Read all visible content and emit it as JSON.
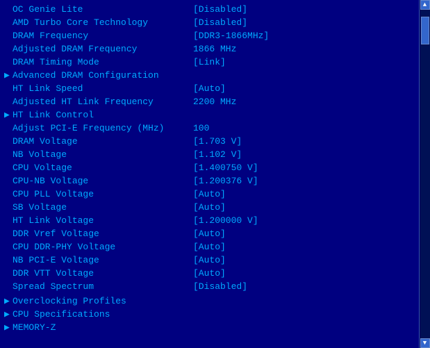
{
  "bios": {
    "rows": [
      {
        "id": "oc-genie-lite",
        "arrow": "",
        "label": "OC Genie Lite",
        "value": "[Disabled]",
        "indent": false
      },
      {
        "id": "amd-turbo-core",
        "arrow": "",
        "label": "AMD Turbo Core Technology",
        "value": "[Disabled]",
        "indent": false
      },
      {
        "id": "dram-frequency",
        "arrow": "",
        "label": "DRAM Frequency",
        "value": "[DDR3-1866MHz]",
        "indent": false
      },
      {
        "id": "adj-dram-frequency",
        "arrow": "",
        "label": "Adjusted DRAM Frequency",
        "value": "1866 MHz",
        "indent": false
      },
      {
        "id": "dram-timing-mode",
        "arrow": "",
        "label": "DRAM Timing Mode",
        "value": "[Link]",
        "indent": false
      },
      {
        "id": "adv-dram-config",
        "arrow": "▶",
        "label": "Advanced DRAM Configuration",
        "value": "",
        "indent": false
      },
      {
        "id": "ht-link-speed",
        "arrow": "",
        "label": "HT Link Speed",
        "value": "[Auto]",
        "indent": false
      },
      {
        "id": "adj-ht-link-freq",
        "arrow": "",
        "label": "Adjusted HT Link Frequency",
        "value": "2200 MHz",
        "indent": false
      },
      {
        "id": "ht-link-control",
        "arrow": "▶",
        "label": "HT Link Control",
        "value": "",
        "indent": false
      },
      {
        "id": "adj-pcie-freq",
        "arrow": "",
        "label": "Adjust PCI-E Frequency (MHz)",
        "value": "100",
        "indent": false
      },
      {
        "id": "dram-voltage",
        "arrow": "",
        "label": "DRAM Voltage",
        "value": "[1.703 V]",
        "indent": false
      },
      {
        "id": "nb-voltage",
        "arrow": "",
        "label": "NB Voltage",
        "value": "[1.102 V]",
        "indent": false
      },
      {
        "id": "cpu-voltage",
        "arrow": "",
        "label": "CPU Voltage",
        "value": "[1.400750 V]",
        "indent": false
      },
      {
        "id": "cpu-nb-voltage",
        "arrow": "",
        "label": "CPU-NB Voltage",
        "value": "[1.200376 V]",
        "indent": false
      },
      {
        "id": "cpu-pll-voltage",
        "arrow": "",
        "label": "CPU PLL Voltage",
        "value": "[Auto]",
        "indent": false
      },
      {
        "id": "sb-voltage",
        "arrow": "",
        "label": "SB Voltage",
        "value": "[Auto]",
        "indent": false
      },
      {
        "id": "ht-link-voltage",
        "arrow": "",
        "label": "HT Link Voltage",
        "value": "[1.200000 V]",
        "indent": false
      },
      {
        "id": "ddr-vref-voltage",
        "arrow": "",
        "label": "DDR Vref Voltage",
        "value": "[Auto]",
        "indent": false
      },
      {
        "id": "cpu-ddr-phy",
        "arrow": "",
        "label": "CPU DDR-PHY Voltage",
        "value": "[Auto]",
        "indent": false
      },
      {
        "id": "nb-pcie-voltage",
        "arrow": "",
        "label": "NB PCI-E Voltage",
        "value": "[Auto]",
        "indent": false
      },
      {
        "id": "ddr-vtt-voltage",
        "arrow": "",
        "label": "DDR VTT Voltage",
        "value": "[Auto]",
        "indent": false
      },
      {
        "id": "spread-spectrum",
        "arrow": "",
        "label": "Spread Spectrum",
        "value": "[Disabled]",
        "indent": false
      }
    ],
    "bottom_items": [
      {
        "id": "overclocking-profiles",
        "arrow": "▶",
        "label": "Overclocking Profiles"
      },
      {
        "id": "cpu-specifications",
        "arrow": "▶",
        "label": "CPU Specifications"
      },
      {
        "id": "memory-z",
        "arrow": "▶",
        "label": "MEMORY-Z"
      }
    ],
    "scrollbar": {
      "up_arrow": "▲",
      "down_arrow": "▼"
    }
  }
}
